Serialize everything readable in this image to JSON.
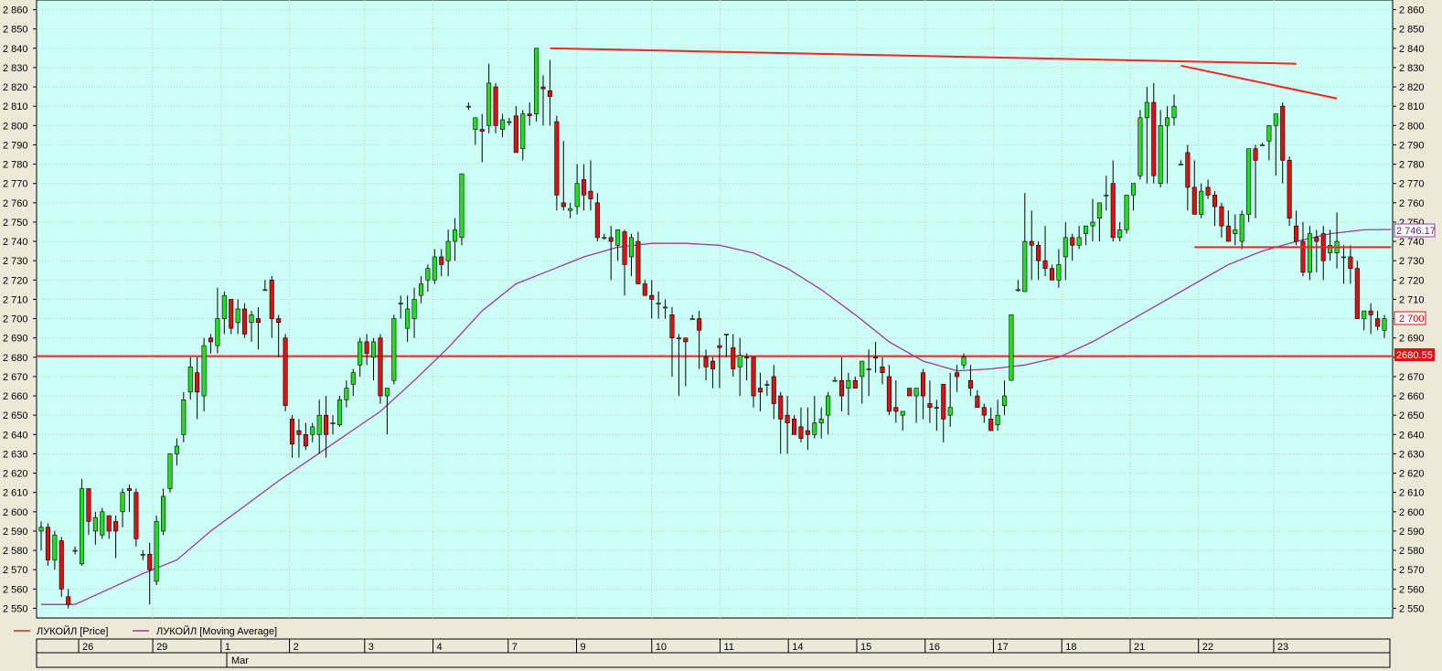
{
  "legend": {
    "price_label": "ЛУКОЙЛ [Price]",
    "ma_label": "ЛУКОЙЛ [Moving Average]",
    "price_color": "#e02020",
    "ma_color": "#9a3aa0"
  },
  "colors": {
    "plot_bg": "#ccfff5",
    "grid": "#b8d0c8",
    "up": "#22dd22",
    "down": "#dd1111",
    "outline": "#000000",
    "trendline": "#ff2020",
    "ma": "#9a3aa0"
  },
  "badges": {
    "ma_value": "2 746.17",
    "last_price": "2 700",
    "hline_value": "2680.55"
  },
  "date_axis": {
    "days": [
      "26",
      "29",
      "1",
      "2",
      "3",
      "4",
      "7",
      "9",
      "10",
      "11",
      "14",
      "15",
      "16",
      "17",
      "18",
      "21",
      "22",
      "23"
    ],
    "month_label": "Mar"
  },
  "chart_data": {
    "type": "candlestick",
    "symbol": "ЛУКОЙЛ",
    "ylim": [
      2545,
      2865
    ],
    "yticks": [
      "2 550",
      "2 560",
      "2 570",
      "2 580",
      "2 590",
      "2 600",
      "2 610",
      "2 620",
      "2 630",
      "2 640",
      "2 650",
      "2 660",
      "2 670",
      "2 680",
      "2 690",
      "2 700",
      "2 710",
      "2 720",
      "2 730",
      "2 740",
      "2 750",
      "2 760",
      "2 770",
      "2 780",
      "2 790",
      "2 800",
      "2 810",
      "2 820",
      "2 830",
      "2 840",
      "2 850",
      "2 860"
    ],
    "candles": [
      [
        2590,
        2595,
        2580,
        2592
      ],
      [
        2592,
        2594,
        2572,
        2575
      ],
      [
        2575,
        2590,
        2570,
        2588
      ],
      [
        2585,
        2587,
        2556,
        2560
      ],
      [
        2556,
        2560,
        2550,
        2552
      ],
      [
        2580,
        2582,
        2578,
        2580
      ],
      [
        2573,
        2617,
        2572,
        2612
      ],
      [
        2612,
        2612,
        2588,
        2595
      ],
      [
        2590,
        2600,
        2583,
        2597
      ],
      [
        2588,
        2602,
        2586,
        2600
      ],
      [
        2598,
        2598,
        2586,
        2590
      ],
      [
        2595,
        2598,
        2576,
        2590
      ],
      [
        2600,
        2612,
        2592,
        2610
      ],
      [
        2612,
        2614,
        2600,
        2611
      ],
      [
        2610,
        2612,
        2582,
        2586
      ],
      [
        2578,
        2580,
        2575,
        2578
      ],
      [
        2578,
        2584,
        2552,
        2570
      ],
      [
        2564,
        2598,
        2562,
        2595
      ],
      [
        2590,
        2612,
        2588,
        2608
      ],
      [
        2612,
        2628,
        2610,
        2630
      ],
      [
        2630,
        2638,
        2624,
        2634
      ],
      [
        2640,
        2662,
        2636,
        2658
      ],
      [
        2662,
        2680,
        2658,
        2675
      ],
      [
        2672,
        2680,
        2648,
        2662
      ],
      [
        2660,
        2690,
        2652,
        2686
      ],
      [
        2690,
        2692,
        2682,
        2688
      ],
      [
        2686,
        2716,
        2682,
        2700
      ],
      [
        2700,
        2714,
        2692,
        2712
      ],
      [
        2710,
        2710,
        2692,
        2695
      ],
      [
        2698,
        2710,
        2692,
        2705
      ],
      [
        2705,
        2708,
        2690,
        2692
      ],
      [
        2698,
        2704,
        2688,
        2702
      ],
      [
        2700,
        2706,
        2684,
        2698
      ],
      [
        2715,
        2720,
        2715,
        2715
      ],
      [
        2720,
        2722,
        2690,
        2700
      ],
      [
        2700,
        2702,
        2680,
        2698
      ],
      [
        2690,
        2692,
        2652,
        2655
      ],
      [
        2648,
        2650,
        2628,
        2635
      ],
      [
        2642,
        2648,
        2628,
        2640
      ],
      [
        2640,
        2646,
        2632,
        2634
      ],
      [
        2640,
        2646,
        2636,
        2644
      ],
      [
        2640,
        2658,
        2630,
        2650
      ],
      [
        2650,
        2660,
        2628,
        2640
      ],
      [
        2646,
        2650,
        2640,
        2646
      ],
      [
        2645,
        2660,
        2644,
        2658
      ],
      [
        2658,
        2668,
        2654,
        2664
      ],
      [
        2666,
        2674,
        2660,
        2672
      ],
      [
        2676,
        2690,
        2670,
        2688
      ],
      [
        2688,
        2692,
        2676,
        2682
      ],
      [
        2680,
        2690,
        2668,
        2688
      ],
      [
        2690,
        2692,
        2656,
        2660
      ],
      [
        2660,
        2664,
        2640,
        2664
      ],
      [
        2668,
        2702,
        2666,
        2700
      ],
      [
        2708,
        2712,
        2700,
        2708
      ],
      [
        2695,
        2712,
        2688,
        2705
      ],
      [
        2700,
        2716,
        2690,
        2710
      ],
      [
        2712,
        2722,
        2708,
        2718
      ],
      [
        2720,
        2728,
        2714,
        2726
      ],
      [
        2720,
        2736,
        2718,
        2732
      ],
      [
        2732,
        2736,
        2722,
        2728
      ],
      [
        2730,
        2746,
        2722,
        2740
      ],
      [
        2740,
        2752,
        2730,
        2746
      ],
      [
        2742,
        2774,
        2738,
        2775
      ],
      [
        2810,
        2812,
        2808,
        2810
      ],
      [
        2798,
        2804,
        2790,
        2804
      ],
      [
        2798,
        2806,
        2781,
        2797
      ],
      [
        2800,
        2832,
        2796,
        2822
      ],
      [
        2820,
        2822,
        2796,
        2800
      ],
      [
        2798,
        2806,
        2794,
        2803
      ],
      [
        2802,
        2804,
        2800,
        2802
      ],
      [
        2805,
        2810,
        2786,
        2786
      ],
      [
        2788,
        2808,
        2782,
        2806
      ],
      [
        2806,
        2812,
        2800,
        2805
      ],
      [
        2806,
        2840,
        2802,
        2840
      ],
      [
        2820,
        2826,
        2800,
        2819
      ],
      [
        2818,
        2834,
        2800,
        2815
      ],
      [
        2802,
        2805,
        2756,
        2764
      ],
      [
        2760,
        2792,
        2756,
        2758
      ],
      [
        2756,
        2760,
        2752,
        2757
      ],
      [
        2758,
        2780,
        2754,
        2770
      ],
      [
        2772,
        2780,
        2756,
        2764
      ],
      [
        2766,
        2782,
        2756,
        2762
      ],
      [
        2760,
        2765,
        2740,
        2742
      ],
      [
        2742,
        2744,
        2741,
        2742
      ],
      [
        2742,
        2748,
        2720,
        2740
      ],
      [
        2738,
        2742,
        2730,
        2746
      ],
      [
        2745,
        2746,
        2712,
        2728
      ],
      [
        2732,
        2744,
        2722,
        2742
      ],
      [
        2740,
        2745,
        2718,
        2718
      ],
      [
        2718,
        2720,
        2712,
        2712
      ],
      [
        2712,
        2720,
        2700,
        2710
      ],
      [
        2708,
        2714,
        2700,
        2708
      ],
      [
        2706,
        2710,
        2700,
        2706
      ],
      [
        2702,
        2706,
        2670,
        2690
      ],
      [
        2690,
        2692,
        2660,
        2690
      ],
      [
        2690,
        2690,
        2665,
        2688
      ],
      [
        2700,
        2702,
        2700,
        2700
      ],
      [
        2700,
        2704,
        2674,
        2694
      ],
      [
        2680,
        2684,
        2668,
        2675
      ],
      [
        2678,
        2680,
        2664,
        2674
      ],
      [
        2686,
        2690,
        2664,
        2685
      ],
      [
        2692,
        2692,
        2680,
        2692
      ],
      [
        2685,
        2692,
        2670,
        2674
      ],
      [
        2675,
        2690,
        2660,
        2681
      ],
      [
        2680,
        2682,
        2668,
        2680
      ],
      [
        2680,
        2680,
        2654,
        2660
      ],
      [
        2664,
        2672,
        2652,
        2662
      ],
      [
        2666,
        2668,
        2660,
        2666
      ],
      [
        2670,
        2676,
        2648,
        2656
      ],
      [
        2660,
        2662,
        2630,
        2648
      ],
      [
        2650,
        2660,
        2630,
        2646
      ],
      [
        2648,
        2650,
        2640,
        2640
      ],
      [
        2644,
        2654,
        2636,
        2638
      ],
      [
        2642,
        2654,
        2632,
        2640
      ],
      [
        2640,
        2660,
        2638,
        2646
      ],
      [
        2646,
        2654,
        2638,
        2648
      ],
      [
        2650,
        2662,
        2640,
        2660
      ],
      [
        2668,
        2670,
        2668,
        2668
      ],
      [
        2668,
        2680,
        2652,
        2660
      ],
      [
        2664,
        2672,
        2650,
        2668
      ],
      [
        2668,
        2670,
        2664,
        2664
      ],
      [
        2670,
        2676,
        2656,
        2678
      ],
      [
        2674,
        2684,
        2660,
        2674
      ],
      [
        2680,
        2688,
        2672,
        2680
      ],
      [
        2675,
        2680,
        2666,
        2672
      ],
      [
        2670,
        2676,
        2650,
        2652
      ],
      [
        2654,
        2668,
        2646,
        2652
      ],
      [
        2650,
        2652,
        2642,
        2652
      ],
      [
        2664,
        2664,
        2660,
        2660
      ],
      [
        2660,
        2664,
        2646,
        2664
      ],
      [
        2672,
        2674,
        2648,
        2660
      ],
      [
        2656,
        2668,
        2646,
        2654
      ],
      [
        2654,
        2658,
        2642,
        2654
      ],
      [
        2666,
        2666,
        2636,
        2648
      ],
      [
        2650,
        2672,
        2644,
        2654
      ],
      [
        2672,
        2676,
        2662,
        2670
      ],
      [
        2676,
        2682,
        2674,
        2680
      ],
      [
        2668,
        2676,
        2660,
        2664
      ],
      [
        2660,
        2663,
        2654,
        2654
      ],
      [
        2654,
        2656,
        2646,
        2650
      ],
      [
        2648,
        2654,
        2642,
        2642
      ],
      [
        2645,
        2658,
        2642,
        2650
      ],
      [
        2655,
        2668,
        2650,
        2660
      ],
      [
        2668,
        2702,
        2668,
        2702
      ],
      [
        2715,
        2720,
        2714,
        2715
      ],
      [
        2714,
        2765,
        2714,
        2740
      ],
      [
        2740,
        2756,
        2720,
        2738
      ],
      [
        2738,
        2740,
        2720,
        2730
      ],
      [
        2730,
        2748,
        2722,
        2726
      ],
      [
        2726,
        2728,
        2720,
        2720
      ],
      [
        2720,
        2736,
        2716,
        2728
      ],
      [
        2732,
        2750,
        2720,
        2742
      ],
      [
        2742,
        2744,
        2730,
        2738
      ],
      [
        2738,
        2748,
        2736,
        2742
      ],
      [
        2744,
        2748,
        2738,
        2748
      ],
      [
        2748,
        2762,
        2740,
        2750
      ],
      [
        2752,
        2760,
        2740,
        2760
      ],
      [
        2764,
        2774,
        2756,
        2764
      ],
      [
        2770,
        2782,
        2740,
        2742
      ],
      [
        2742,
        2750,
        2740,
        2746
      ],
      [
        2746,
        2760,
        2744,
        2764
      ],
      [
        2764,
        2766,
        2756,
        2770
      ],
      [
        2774,
        2808,
        2772,
        2804
      ],
      [
        2804,
        2820,
        2770,
        2812
      ],
      [
        2812,
        2822,
        2770,
        2774
      ],
      [
        2770,
        2808,
        2768,
        2800
      ],
      [
        2800,
        2810,
        2770,
        2804
      ],
      [
        2804,
        2816,
        2800,
        2810
      ],
      [
        2780,
        2782,
        2780,
        2780
      ],
      [
        2786,
        2790,
        2756,
        2768
      ],
      [
        2768,
        2782,
        2758,
        2754
      ],
      [
        2754,
        2770,
        2752,
        2766
      ],
      [
        2768,
        2772,
        2762,
        2764
      ],
      [
        2764,
        2766,
        2748,
        2758
      ],
      [
        2758,
        2760,
        2742,
        2748
      ],
      [
        2748,
        2756,
        2744,
        2740
      ],
      [
        2744,
        2754,
        2738,
        2746
      ],
      [
        2740,
        2756,
        2736,
        2754
      ],
      [
        2754,
        2788,
        2750,
        2788
      ],
      [
        2788,
        2790,
        2752,
        2782
      ],
      [
        2790,
        2791,
        2790,
        2790
      ],
      [
        2792,
        2796,
        2782,
        2800
      ],
      [
        2800,
        2806,
        2774,
        2806
      ],
      [
        2810,
        2812,
        2770,
        2782
      ],
      [
        2782,
        2784,
        2748,
        2752
      ],
      [
        2748,
        2756,
        2738,
        2740
      ],
      [
        2740,
        2750,
        2722,
        2724
      ],
      [
        2724,
        2748,
        2720,
        2744
      ],
      [
        2742,
        2746,
        2724,
        2740
      ],
      [
        2744,
        2748,
        2720,
        2730
      ],
      [
        2734,
        2746,
        2730,
        2738
      ],
      [
        2734,
        2755,
        2726,
        2740
      ],
      [
        2732,
        2738,
        2718,
        2732
      ],
      [
        2732,
        2738,
        2718,
        2726
      ],
      [
        2726,
        2730,
        2712,
        2700
      ],
      [
        2700,
        2702,
        2694,
        2704
      ],
      [
        2704,
        2708,
        2692,
        2702
      ],
      [
        2700,
        2704,
        2694,
        2696
      ],
      [
        2694,
        2702,
        2690,
        2700
      ]
    ],
    "moving_average": [
      [
        0,
        2552
      ],
      [
        5,
        2552
      ],
      [
        10,
        2560
      ],
      [
        15,
        2568
      ],
      [
        20,
        2575
      ],
      [
        25,
        2590
      ],
      [
        30,
        2603
      ],
      [
        35,
        2616
      ],
      [
        40,
        2628
      ],
      [
        45,
        2640
      ],
      [
        50,
        2652
      ],
      [
        55,
        2668
      ],
      [
        60,
        2685
      ],
      [
        65,
        2704
      ],
      [
        70,
        2718
      ],
      [
        75,
        2725
      ],
      [
        80,
        2732
      ],
      [
        85,
        2737
      ],
      [
        90,
        2739
      ],
      [
        95,
        2739
      ],
      [
        100,
        2738
      ],
      [
        105,
        2734
      ],
      [
        110,
        2726
      ],
      [
        115,
        2715
      ],
      [
        120,
        2702
      ],
      [
        125,
        2688
      ],
      [
        130,
        2678
      ],
      [
        135,
        2673
      ],
      [
        140,
        2674
      ],
      [
        145,
        2676
      ],
      [
        150,
        2680
      ],
      [
        155,
        2688
      ],
      [
        160,
        2698
      ],
      [
        165,
        2708
      ],
      [
        170,
        2718
      ],
      [
        175,
        2728
      ],
      [
        180,
        2735
      ],
      [
        185,
        2740
      ],
      [
        190,
        2744
      ],
      [
        195,
        2746
      ],
      [
        199,
        2746.17
      ]
    ],
    "horizontal_line": 2680.55,
    "trendlines": [
      {
        "from": [
          75,
          2840
        ],
        "to": [
          185,
          2832
        ]
      },
      {
        "from": [
          168,
          2831
        ],
        "to": [
          191,
          2814
        ]
      },
      {
        "from": [
          170,
          2737
        ],
        "to": [
          199,
          2737
        ]
      }
    ],
    "x_axis_days": [
      "26",
      "29",
      "1",
      "2",
      "3",
      "4",
      "7",
      "9",
      "10",
      "11",
      "14",
      "15",
      "16",
      "17",
      "18",
      "21",
      "22",
      "23"
    ],
    "x_axis_month": "Mar",
    "grid": true,
    "legend_position": "bottom-left"
  }
}
